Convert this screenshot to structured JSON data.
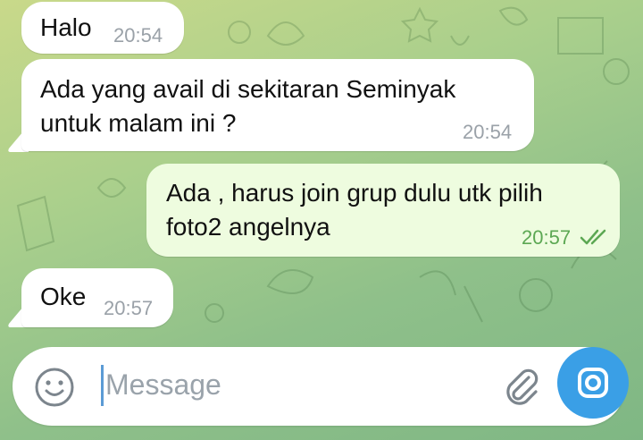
{
  "messages": [
    {
      "direction": "in",
      "text": "Halo",
      "time": "20:54"
    },
    {
      "direction": "in",
      "text": "Ada yang avail di sekitaran Seminyak\nuntuk malam ini ?",
      "time": "20:54"
    },
    {
      "direction": "out",
      "text": "Ada , harus join grup dulu utk pilih\nfoto2 angelnya",
      "time": "20:57",
      "status": "read"
    },
    {
      "direction": "in",
      "text": "Oke",
      "time": "20:57"
    }
  ],
  "composer": {
    "placeholder": "Message",
    "icons": {
      "emoji": "smiley-icon",
      "attach": "paperclip-icon",
      "send": "camera-icon"
    }
  },
  "colors": {
    "incoming_bubble": "#ffffff",
    "outgoing_bubble": "#eefcdf",
    "outgoing_time": "#5ca853",
    "accent": "#3a9fe6"
  }
}
